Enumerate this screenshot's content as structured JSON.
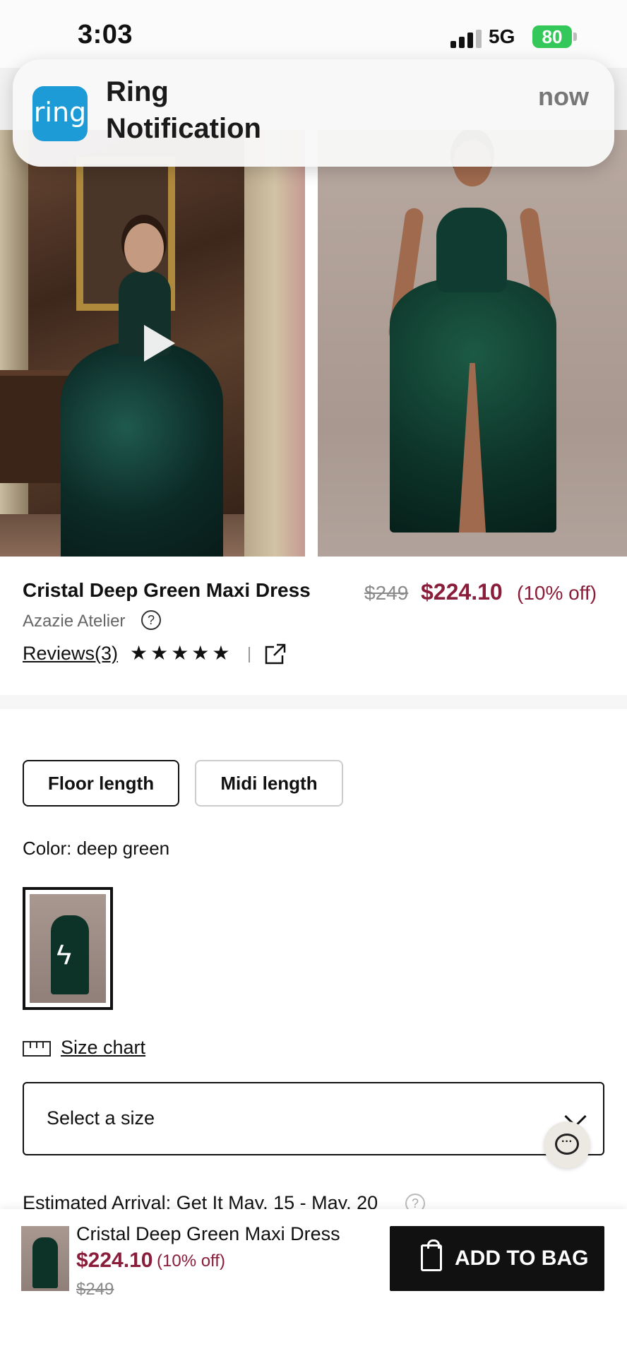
{
  "status_bar": {
    "time": "3:03",
    "network": "5G",
    "battery": "80"
  },
  "notification": {
    "app_icon_text": "ring",
    "title": "Ring",
    "body": "Notification",
    "time": "now"
  },
  "product": {
    "title": "Cristal Deep Green Maxi Dress",
    "brand": "Azazie Atelier",
    "price_original": "$249",
    "price_sale": "$224.10",
    "discount": "(10% off)",
    "reviews_label": "Reviews(3)",
    "rating_stars": "★★★★★",
    "rating": 5
  },
  "length_tabs": [
    {
      "label": "Floor length",
      "selected": true
    },
    {
      "label": "Midi length",
      "selected": false
    }
  ],
  "color": {
    "label": "Color: deep green"
  },
  "size_chart_label": "Size chart",
  "size_select": {
    "placeholder": "Select a size"
  },
  "arrival": {
    "text": "Estimated Arrival: Get It May. 15 - May. 20"
  },
  "bottom_bar": {
    "title": "Cristal Deep Green Maxi Dress",
    "price": "$224.10",
    "discount": "(10% off)",
    "original": "$249",
    "button_label": "ADD TO BAG"
  },
  "colors": {
    "sale_price": "#8a1d3a",
    "battery": "#34c759",
    "ring_brand": "#1d9bd7"
  }
}
